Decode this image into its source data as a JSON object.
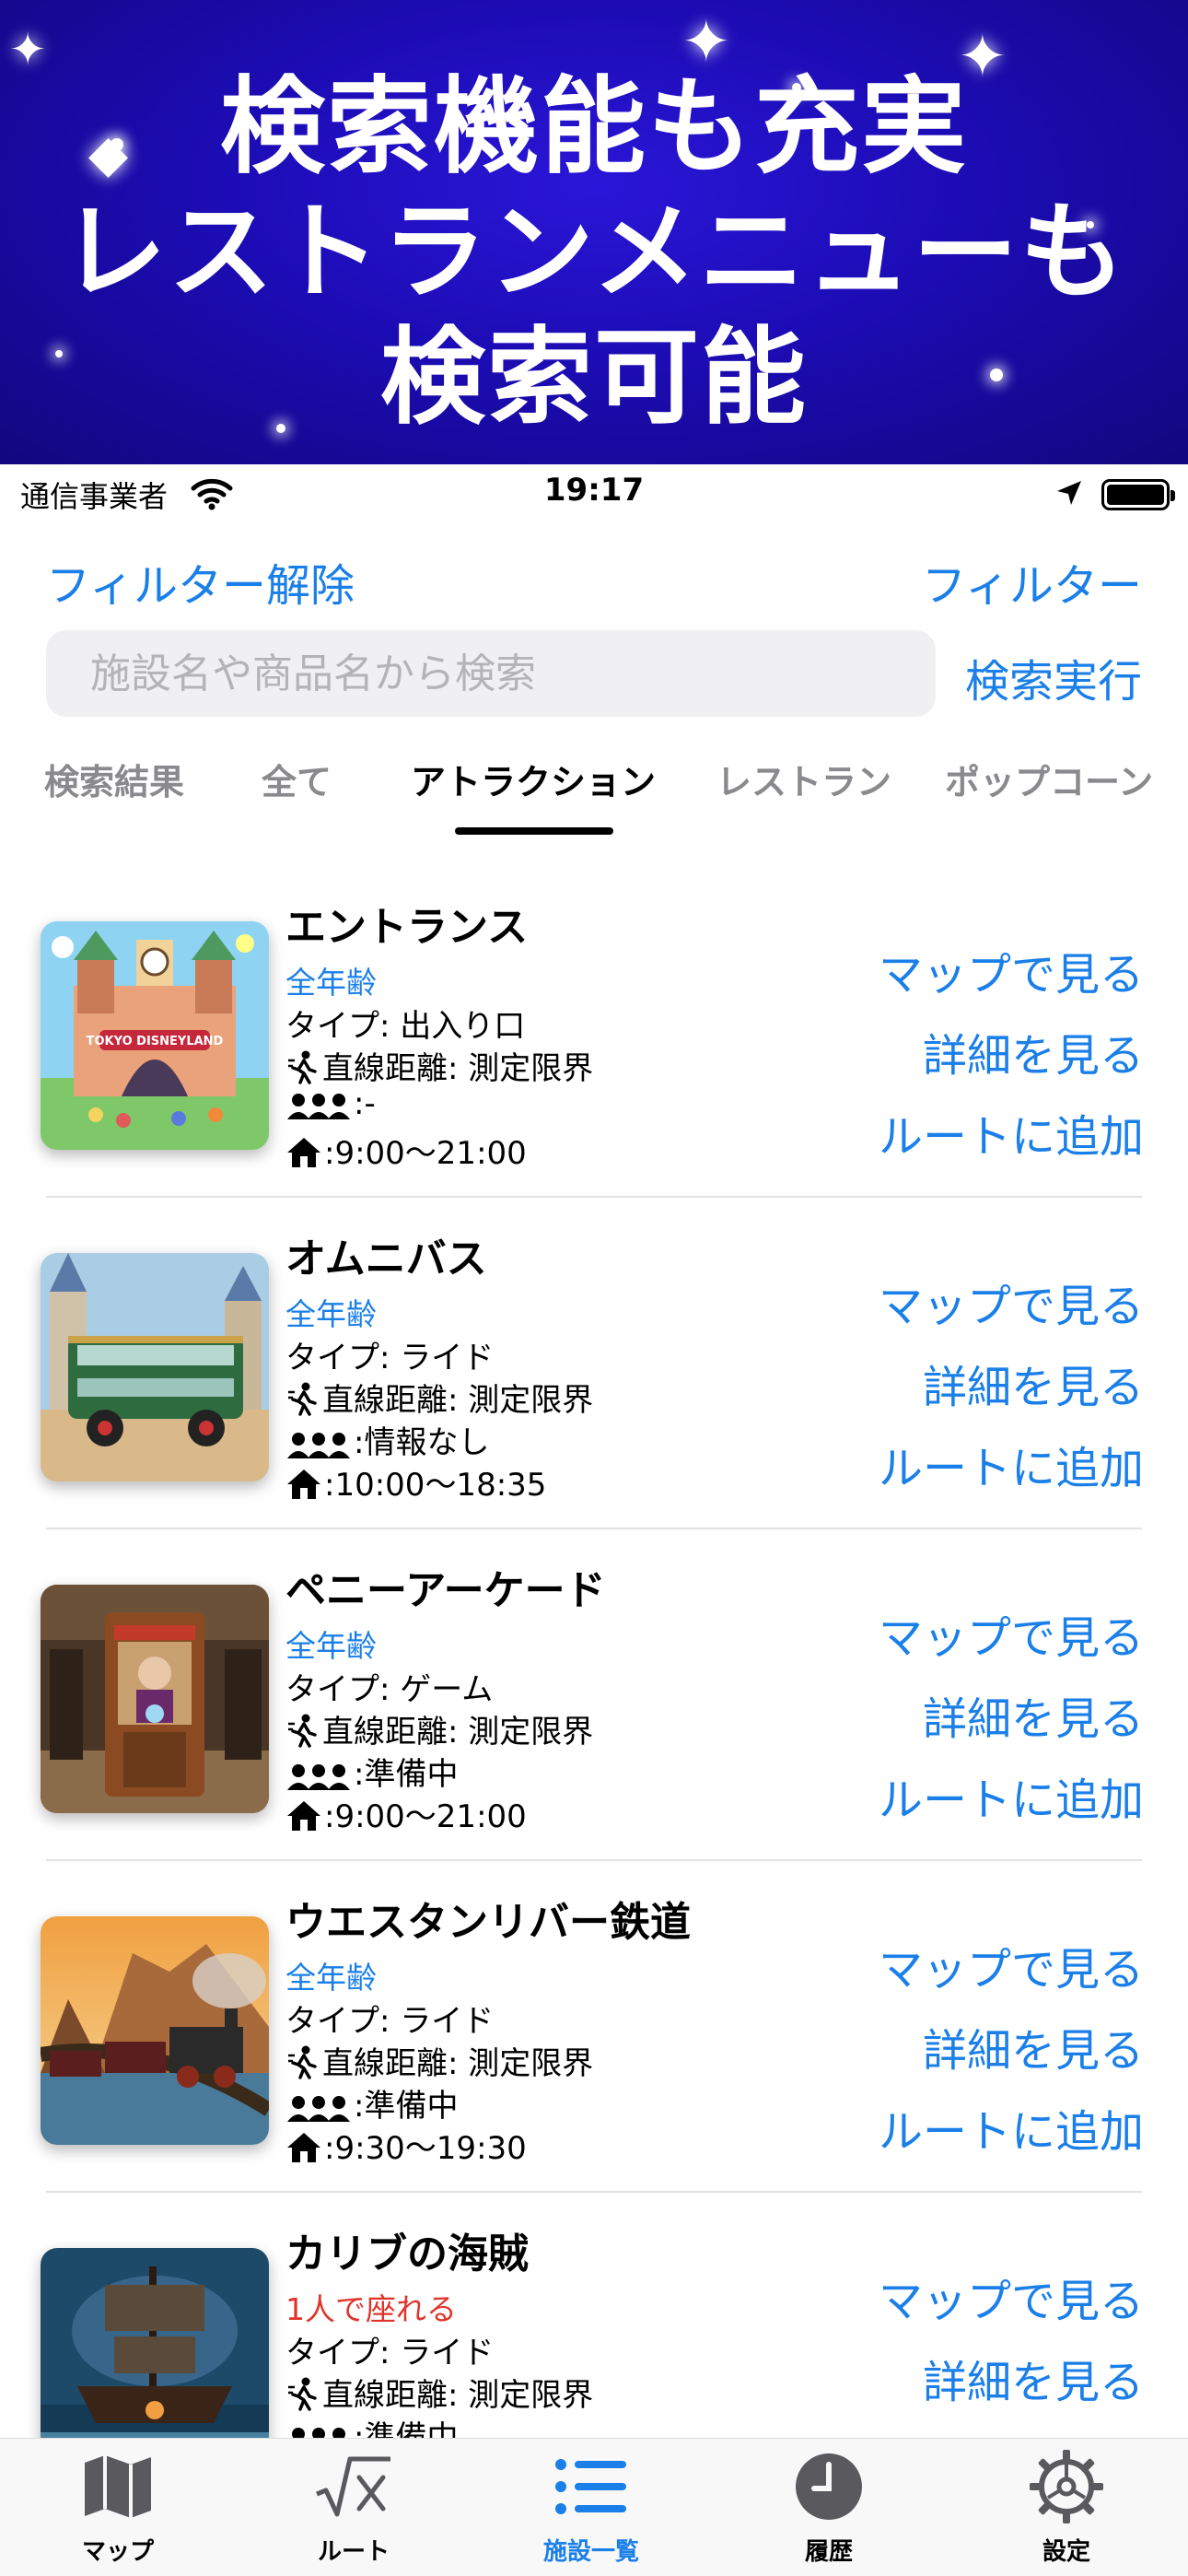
{
  "banner": {
    "line1": "検索機能も充実",
    "line2": "レストランメニューも",
    "line3": "検索可能"
  },
  "status_bar": {
    "carrier": "通信事業者",
    "time": "19:17"
  },
  "filter_clear_label": "フィルター解除",
  "filter_label": "フィルター",
  "search": {
    "placeholder": "施設名や商品名から検索",
    "value": "",
    "button_label": "検索実行"
  },
  "tabs": [
    {
      "label": "検索結果",
      "active": false
    },
    {
      "label": "全て",
      "active": false
    },
    {
      "label": "アトラクション",
      "active": true
    },
    {
      "label": "レストラン",
      "active": false
    },
    {
      "label": "ポップコーン",
      "active": false
    }
  ],
  "actions": {
    "map": "マップで見る",
    "detail": "詳細を見る",
    "route": "ルートに追加"
  },
  "items": [
    {
      "name": "エントランス",
      "badge": "全年齢",
      "type": "タイプ: 出入り口",
      "distance": "直線距離: 測定限界",
      "wait": ":-",
      "hours": ":9:00〜21:00"
    },
    {
      "name": "オムニバス",
      "badge": "全年齢",
      "type": "タイプ: ライド",
      "distance": "直線距離: 測定限界",
      "wait": ":情報なし",
      "hours": ":10:00〜18:35"
    },
    {
      "name": "ペニーアーケード",
      "badge": "全年齢",
      "type": "タイプ: ゲーム",
      "distance": "直線距離: 測定限界",
      "wait": ":準備中",
      "hours": ":9:00〜21:00"
    },
    {
      "name": "ウエスタンリバー鉄道",
      "badge": "全年齢",
      "type": "タイプ: ライド",
      "distance": "直線距離: 測定限界",
      "wait": ":準備中",
      "hours": ":9:30〜19:30"
    },
    {
      "name": "カリブの海賊",
      "badge": "1人で座れる",
      "type": "タイプ: ライド",
      "distance": "直線距離: 測定限界",
      "wait": ":準備中",
      "hours": ""
    }
  ],
  "thumb_caption": "TOKYO DISNEYLAND",
  "tab_bar": [
    {
      "label": "マップ",
      "icon": "map-icon",
      "active": false
    },
    {
      "label": "ルート",
      "icon": "sqrt-x-icon",
      "active": false
    },
    {
      "label": "施設一覧",
      "icon": "list-icon",
      "active": true
    },
    {
      "label": "履歴",
      "icon": "clock-icon",
      "active": false
    },
    {
      "label": "設定",
      "icon": "gear-icon",
      "active": false
    }
  ],
  "colors": {
    "accent": "#1a7fe8",
    "warning": "#e0342b",
    "banner_bg": "#1c0cb4",
    "tab_inactive": "#8a8a8e"
  }
}
